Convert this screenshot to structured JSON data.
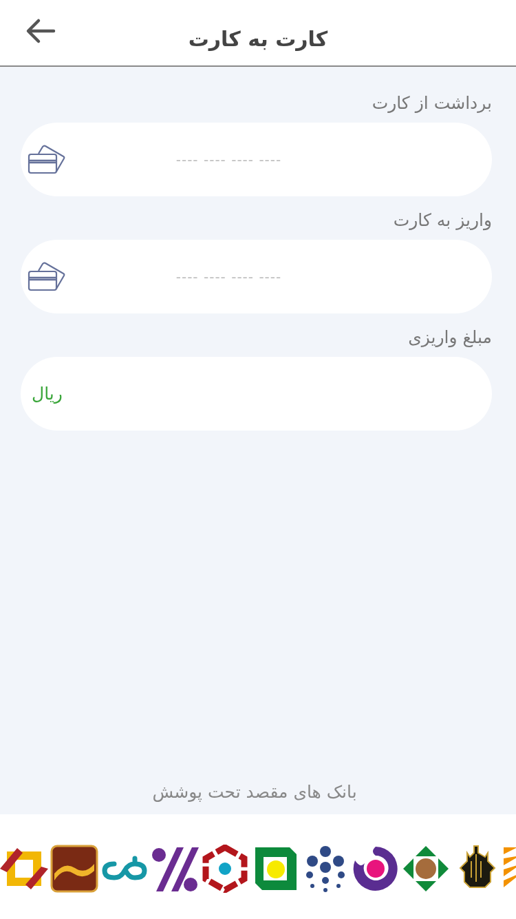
{
  "header": {
    "title": "کارت به کارت"
  },
  "fields": [
    {
      "kind": "card",
      "label": "برداشت از کارت",
      "placeholder": "---- ---- ---- ----"
    },
    {
      "kind": "card",
      "label": "واریز به کارت",
      "placeholder": "---- ---- ---- ----"
    },
    {
      "kind": "amount",
      "label": "مبلغ واریزی",
      "unit": "ریال"
    }
  ],
  "banks": {
    "caption": "بانک های مقصد تحت پوشش"
  }
}
